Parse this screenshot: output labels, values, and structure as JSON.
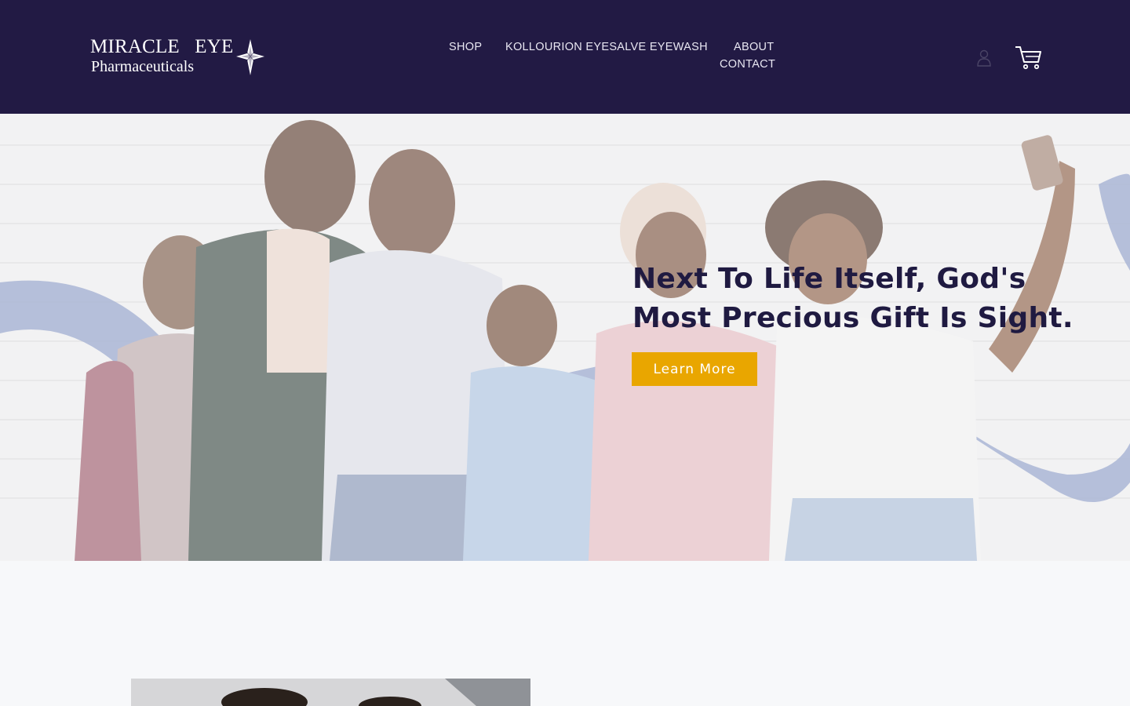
{
  "header": {
    "logo": {
      "line1": "MIRACLE   EYE",
      "line2": "Pharmaceuticals",
      "icon": "star-cross-icon"
    },
    "nav": {
      "shop": "SHOP",
      "kollourion": "KOLLOURION EYESALVE EYEWASH",
      "about": "ABOUT",
      "contact": "CONTACT"
    },
    "account_icon": "account-icon",
    "cart_icon": "cart-icon"
  },
  "hero": {
    "title_line1": "Next To Life Itself, God's",
    "title_line2": "Most Precious Gift Is Sight.",
    "button_label": "Learn More",
    "image": "family-selfie-photo"
  },
  "colors": {
    "header_bg": "#221a44",
    "title_color": "#1f1a41",
    "button_bg": "#e9a600",
    "ribbon": "#7b8bbd",
    "page_bg": "#f7f8fa"
  }
}
